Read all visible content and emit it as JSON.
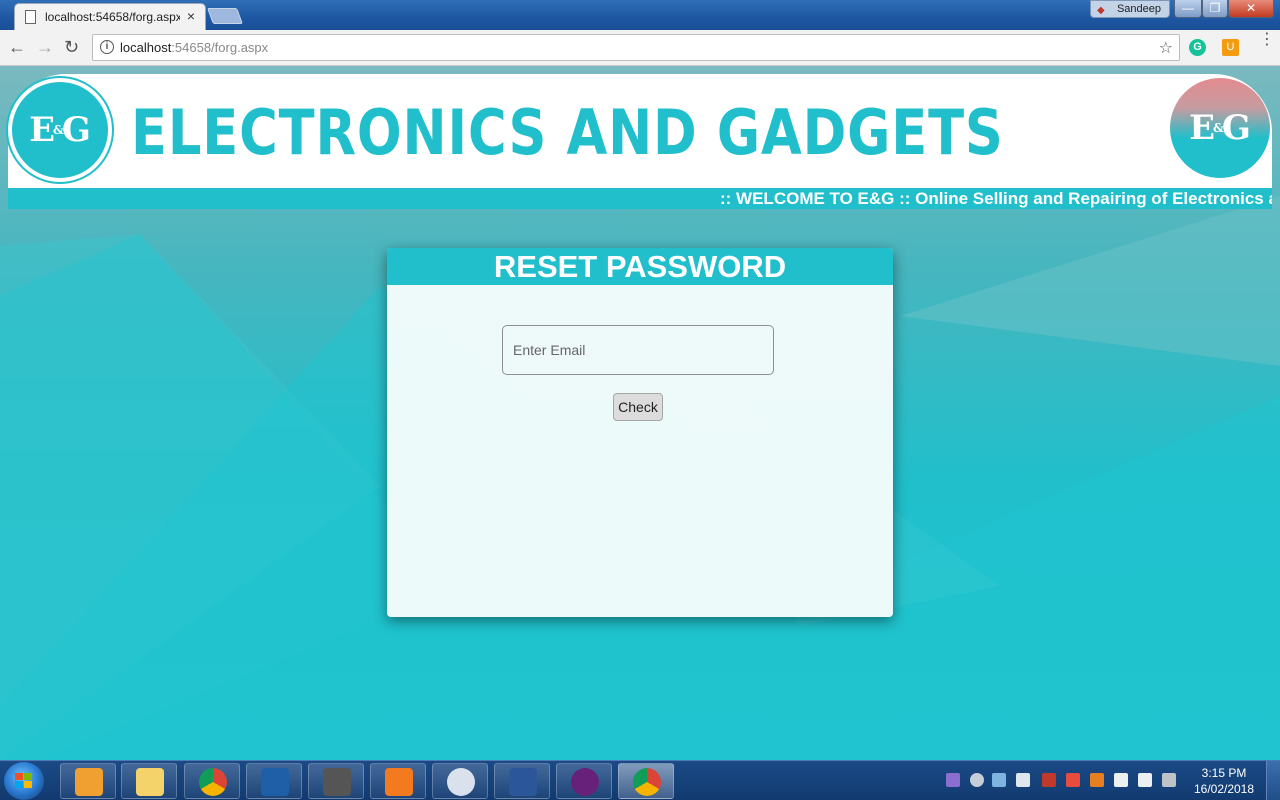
{
  "browser": {
    "tab_title": "localhost:54658/forg.aspx",
    "tab_close": "×",
    "url_host": "localhost",
    "url_path": ":54658/forg.aspx",
    "user_name": "Sandeep",
    "info_glyph": "i",
    "star_glyph": "☆",
    "grammarly_glyph": "G",
    "uc_glyph": "U",
    "menu_glyph": "⋮",
    "back_glyph": "←",
    "forward_glyph": "→",
    "reload_glyph": "↻",
    "min_glyph": "—",
    "max_glyph": "❐",
    "close_glyph": "✕"
  },
  "site": {
    "title": "ELECTRONICS AND GADGETS",
    "logo_text_left": "E",
    "logo_text_amp": "&",
    "logo_text_right": "G",
    "marquee": ":: WELCOME TO E&G :: Online Selling and Repairing of Electronics a",
    "brand_color": "#20bfcb"
  },
  "reset_form": {
    "heading": "RESET PASSWORD",
    "email_placeholder": "Enter Email",
    "email_value": "",
    "check_label": "Check"
  },
  "taskbar": {
    "time": "3:15 PM",
    "date": "16/02/2018",
    "items": [
      "media-player",
      "file-explorer",
      "chrome",
      "powershell",
      "sql-shell",
      "uc-browser",
      "snipping-tool",
      "word",
      "visual-studio",
      "chrome-active"
    ]
  }
}
